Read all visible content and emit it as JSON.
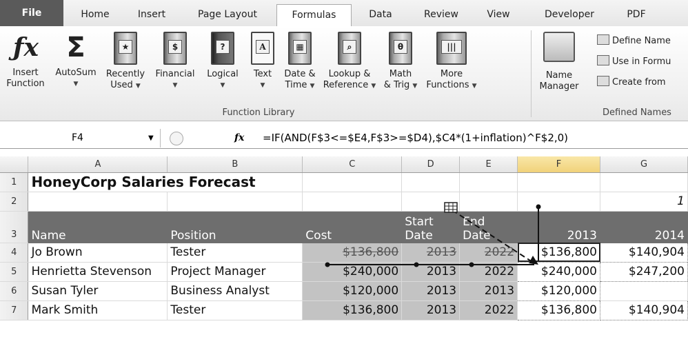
{
  "tabs": [
    "File",
    "Home",
    "Insert",
    "Page Layout",
    "Formulas",
    "Data",
    "Review",
    "View",
    "Developer",
    "PDF"
  ],
  "ribbon": {
    "insert_function": [
      "Insert",
      "Function"
    ],
    "autosum": "AutoSum",
    "recently_used": [
      "Recently",
      "Used"
    ],
    "financial": "Financial",
    "logical": "Logical",
    "text": "Text",
    "date_time": [
      "Date &",
      "Time"
    ],
    "lookup_reference": [
      "Lookup &",
      "Reference"
    ],
    "math_trig": [
      "Math",
      "& Trig"
    ],
    "more_functions": [
      "More",
      "Functions"
    ],
    "function_library_label": "Function Library",
    "name_manager": [
      "Name",
      "Manager"
    ],
    "define_name": "Define Name",
    "use_in_formula": "Use in Formu",
    "create_from": "Create from",
    "defined_names_label": "Defined Names"
  },
  "formula_bar": {
    "name_box": "F4",
    "fx": "fx",
    "formula": "=IF(AND(F$3<=$E4,F$3>=$D4),$C4*(1+inflation)^F$2,0)"
  },
  "columns": [
    "A",
    "B",
    "C",
    "D",
    "E",
    "F",
    "G"
  ],
  "row_numbers": [
    "1",
    "2",
    "3",
    "4",
    "5",
    "6",
    "7"
  ],
  "sheet": {
    "title": "HoneyCorp Salaries Forecast",
    "g2": "1",
    "headers": {
      "name": "Name",
      "position": "Position",
      "cost": "Cost",
      "start": [
        "Start",
        "Date"
      ],
      "end": [
        "End",
        "Date"
      ],
      "y2013": "2013",
      "y2014": "2014"
    },
    "rows": [
      {
        "name": "Jo Brown",
        "position": "Tester",
        "cost": "$136,800",
        "start": "2013",
        "end": "2022",
        "f": "$136,800",
        "g": "$140,904"
      },
      {
        "name": "Henrietta Stevenson",
        "position": "Project Manager",
        "cost": "$240,000",
        "start": "2013",
        "end": "2022",
        "f": "$240,000",
        "g": "$247,200"
      },
      {
        "name": "Susan Tyler",
        "position": "Business Analyst",
        "cost": "$120,000",
        "start": "2013",
        "end": "2013",
        "f": "$120,000",
        "g": ""
      },
      {
        "name": "Mark Smith",
        "position": "Tester",
        "cost": "$136,800",
        "start": "2013",
        "end": "2022",
        "f": "$136,800",
        "g": "$140,904"
      }
    ]
  }
}
